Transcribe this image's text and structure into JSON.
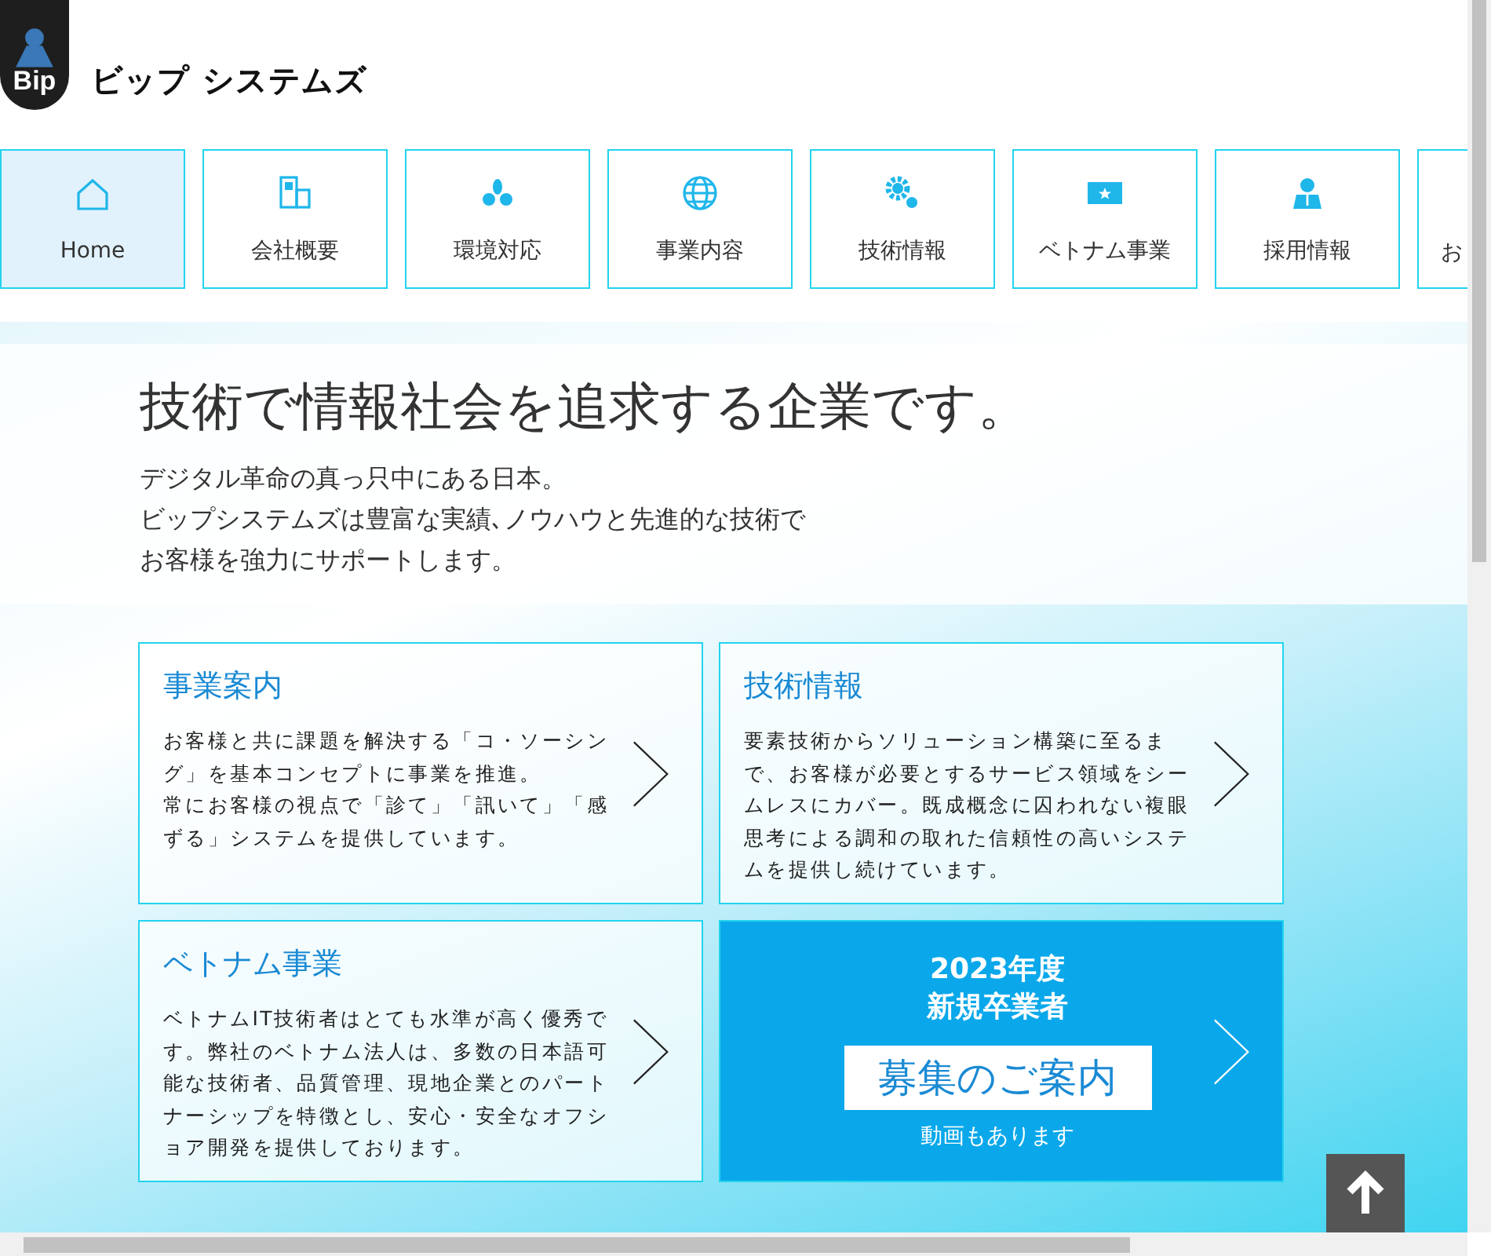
{
  "logo": {
    "mark": "Bip",
    "name": "ビップ システムズ"
  },
  "nav": [
    {
      "label": "Home",
      "kind": "home",
      "selected": true
    },
    {
      "label": "会社概要",
      "kind": "building",
      "selected": false
    },
    {
      "label": "環境対応",
      "kind": "leaves",
      "selected": false
    },
    {
      "label": "事業内容",
      "kind": "globe",
      "selected": false
    },
    {
      "label": "技術情報",
      "kind": "gears",
      "selected": false
    },
    {
      "label": "ベトナム事業",
      "kind": "flag",
      "selected": false
    },
    {
      "label": "採用情報",
      "kind": "person",
      "selected": false
    },
    {
      "label": "お",
      "kind": "cut",
      "selected": false
    }
  ],
  "hero": {
    "headline": "技術で情報社会を追求する企業です。",
    "lines": [
      "デジタル革命の真っ只中にある日本。",
      "ビップシステムズは豊富な実績､ノウハウと先進的な技術で",
      "お客様を強力にサポートします。"
    ]
  },
  "cards": [
    {
      "kind": "info",
      "title": "事業案内",
      "text": [
        "お客様と共に課題を解決する「コ・ソーシング」を基本コンセプトに事業を推進。",
        "常にお客様の視点で「診て」「訊いて」「感ずる」システムを提供しています。"
      ]
    },
    {
      "kind": "info",
      "title": "技術情報",
      "text": [
        "要素技術からソリューション構築に至るまで、お客様が必要とするサービス領域をシームレスにカバー。既成概念に囚われない複眼思考による調和の取れた信頼性の高いシステムを提供し続けています。"
      ]
    },
    {
      "kind": "info",
      "title": "ベトナム事業",
      "text": [
        "ベトナムIT技術者はとても水準が高く優秀です。弊社のベトナム法人は、多数の日本語可能な技術者、品質管理、現地企業とのパートナーシップを特徴とし、安心・安全なオフショア開発を提供しております。"
      ]
    },
    {
      "kind": "recruit",
      "year": "2023年度",
      "subtitle": "新規卒業者",
      "button": "募集のご案内",
      "note": "動画もあります"
    }
  ]
}
